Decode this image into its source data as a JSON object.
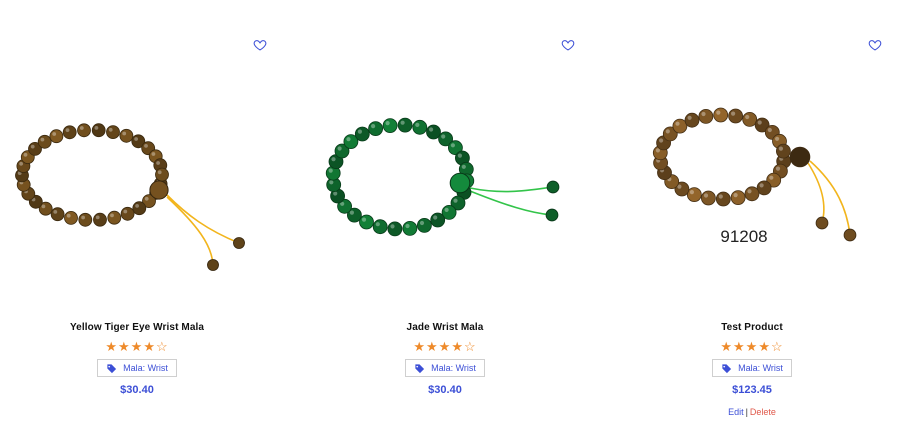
{
  "products": [
    {
      "title": "Yellow Tiger Eye Wrist Mala",
      "rating_value": 4,
      "rating_max": 5,
      "stars": "★★★★☆",
      "category": "Mala: Wrist",
      "price": "$30.40",
      "bead_color": "#6a4a1c",
      "cord_color": "#f2b51d",
      "icons": {
        "wishlist": "heart-outline-icon",
        "tag": "tag-icon"
      }
    },
    {
      "title": "Jade Wrist Mala",
      "rating_value": 4,
      "rating_max": 5,
      "stars": "★★★★☆",
      "category": "Mala: Wrist",
      "price": "$30.40",
      "bead_color": "#0f6a2e",
      "cord_color": "#33c44a",
      "icons": {
        "wishlist": "heart-outline-icon",
        "tag": "tag-icon"
      }
    },
    {
      "title": "Test Product",
      "rating_value": 4,
      "rating_max": 5,
      "stars": "★★★★☆",
      "category": "Mala: Wrist",
      "price": "$123.45",
      "image_caption": "91208",
      "actions": {
        "edit": "Edit",
        "separator": "|",
        "delete": "Delete"
      },
      "bead_color": "#7a5424",
      "cord_color": "#f2b51d",
      "icons": {
        "wishlist": "heart-outline-icon",
        "tag": "tag-icon"
      }
    }
  ],
  "colors": {
    "accent": "#3c4fd6",
    "star": "#ee8a2a",
    "delete": "#e0584a"
  }
}
